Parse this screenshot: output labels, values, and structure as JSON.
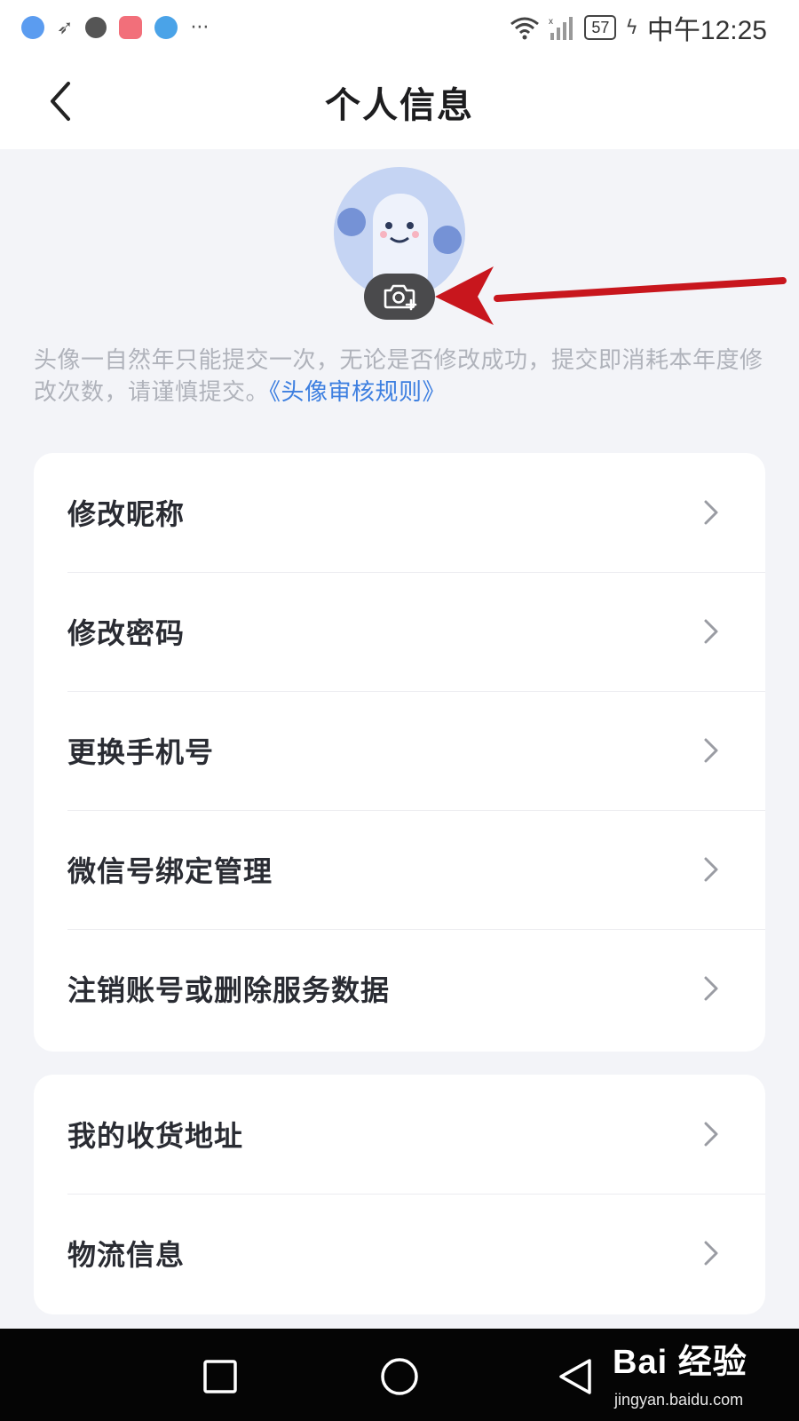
{
  "status_bar": {
    "battery": "57",
    "time": "中午12:25",
    "more": "···",
    "icons": [
      "app-globe-icon",
      "app-send-icon",
      "app-shield-icon",
      "app-huawei-icon",
      "app-fb-icon",
      "wifi-icon",
      "signal-icon",
      "charging-icon"
    ]
  },
  "header": {
    "title": "个人信息",
    "back_icon": "chevron-left-icon"
  },
  "avatar": {
    "camera_icon": "camera-add-icon",
    "arrow_color": "#c8161d"
  },
  "notice": {
    "text": "头像一自然年只能提交一次，无论是否修改成功，提交即消耗本年度修改次数，请谨慎提交。",
    "link": "《头像审核规则》",
    "link_color": "#3d7fe0"
  },
  "menu_group_1": {
    "items": [
      {
        "label": "修改昵称"
      },
      {
        "label": "修改密码"
      },
      {
        "label": "更换手机号"
      },
      {
        "label": "微信号绑定管理"
      },
      {
        "label": "注销账号或删除服务数据"
      }
    ]
  },
  "menu_group_2": {
    "items": [
      {
        "label": "我的收货地址"
      },
      {
        "label": "物流信息"
      }
    ]
  },
  "system_nav": {
    "buttons": [
      "recent-apps-icon",
      "home-icon",
      "back-triangle-icon"
    ]
  },
  "watermark": {
    "logo": "Bai 经验",
    "url": "jingyan.baidu.com"
  }
}
